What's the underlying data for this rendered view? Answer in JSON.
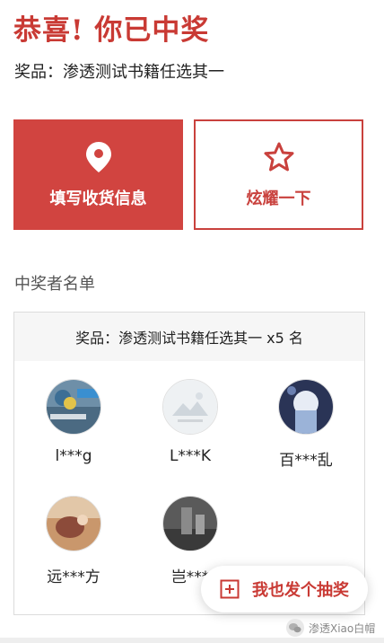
{
  "header": {
    "title": "恭喜! 你已中奖",
    "prize_line": "奖品：渗透测试书籍任选其一"
  },
  "actions": {
    "fill_info": {
      "label": "填写收货信息",
      "icon": "location-pin-icon"
    },
    "show_off": {
      "label": "炫耀一下",
      "icon": "star-icon"
    }
  },
  "winners": {
    "section_title": "中奖者名单",
    "prize_header": "奖品：渗透测试书籍任选其一 x5 名",
    "list": [
      {
        "name": "l***g"
      },
      {
        "name": "L***K"
      },
      {
        "name": "百***乱"
      },
      {
        "name": "远***方"
      },
      {
        "name": "岂***"
      }
    ]
  },
  "fab": {
    "label": "我也发个抽奖",
    "icon": "plus-square-icon"
  },
  "watermark": {
    "text": "渗透Xiao白帽"
  },
  "colors": {
    "accent": "#c93a34",
    "primary_button": "#d14440"
  }
}
